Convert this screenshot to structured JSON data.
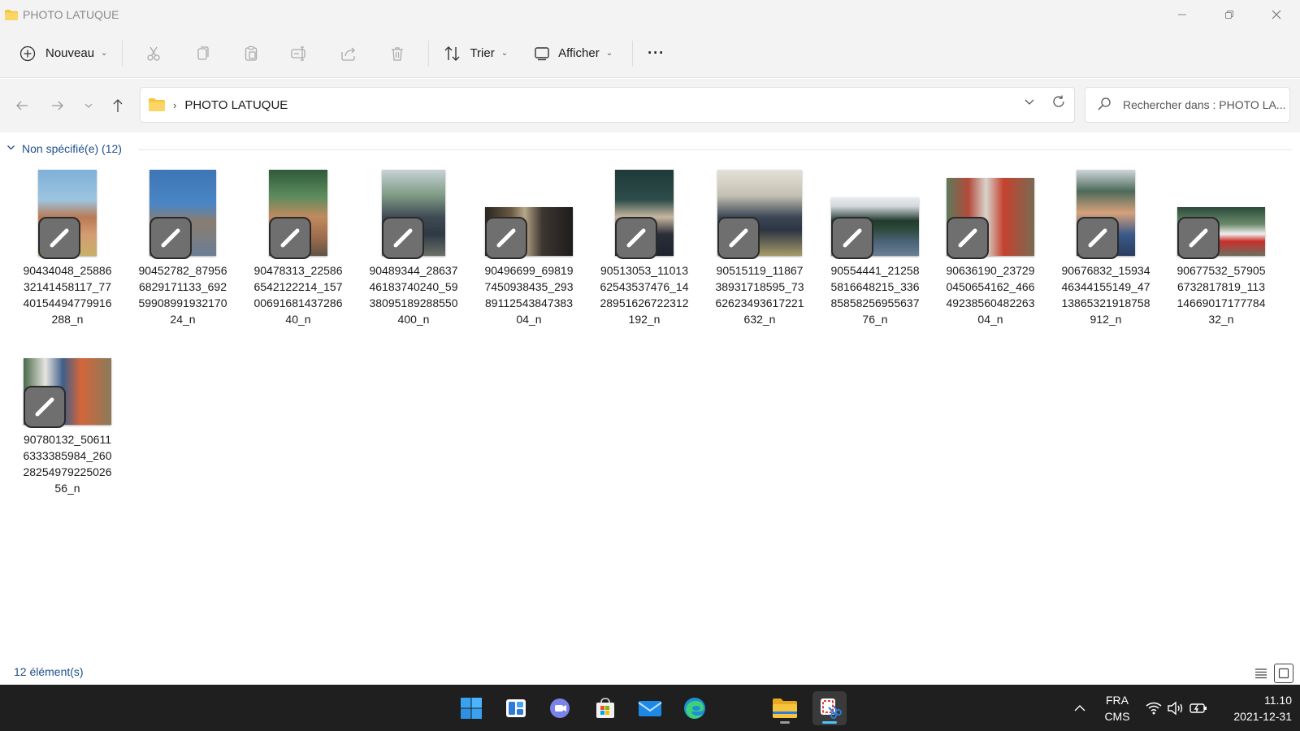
{
  "window": {
    "title": "PHOTO LATUQUE",
    "controls": {
      "minimize": "—",
      "maximize": "❐",
      "close": "✕"
    }
  },
  "toolbar": {
    "new_label": "Nouveau",
    "sort_label": "Trier",
    "view_label": "Afficher",
    "more_label": "···",
    "icons": [
      "cut-icon",
      "copy-icon",
      "paste-icon",
      "rename-icon",
      "share-icon",
      "delete-icon"
    ]
  },
  "address": {
    "crumb": "PHOTO LATUQUE",
    "crumb_separator": "›"
  },
  "search": {
    "placeholder": "Rechercher dans : PHOTO LA..."
  },
  "group": {
    "label": "Non spécifié(e) (12)"
  },
  "files": [
    {
      "name": "90434048_258863214145811 7_7740154494779916288_n",
      "lines": [
        "90434048_25886",
        "32141458117_77",
        "40154494779916",
        "288_n"
      ]
    },
    {
      "lines": [
        "90452782_87956",
        "6829171133_692",
        "59908991932170",
        "24_n"
      ]
    },
    {
      "lines": [
        "90478313_22586",
        "6542122214_157",
        "00691681437286",
        "40_n"
      ]
    },
    {
      "lines": [
        "90489344_28637",
        "46183740240_59",
        "38095189288550",
        "400_n"
      ]
    },
    {
      "lines": [
        "90496699_69819",
        "7450938435_293",
        "89112543847383",
        "04_n"
      ]
    },
    {
      "lines": [
        "90513053_11013",
        "62543537476_14",
        "28951626722312",
        "192_n"
      ]
    },
    {
      "lines": [
        "90515119_11867",
        "38931718595_73",
        "62623493617221",
        "632_n"
      ]
    },
    {
      "lines": [
        "90554441_21258",
        "5816648215_336",
        "85858256955637",
        "76_n"
      ]
    },
    {
      "lines": [
        "90636190_23729",
        "0450654162_466",
        "49238560482263",
        "04_n"
      ]
    },
    {
      "lines": [
        "90676832_15934",
        "46344155149_47",
        "13865321918758",
        "912_n"
      ]
    },
    {
      "lines": [
        "90677532_57905",
        "6732817819_113",
        "14669017177784",
        "32_n"
      ]
    },
    {
      "lines": [
        "90780132_50611",
        "6333385984_260",
        "28254979225026",
        "56_n"
      ]
    }
  ],
  "status": {
    "count": "12 élément(s)"
  },
  "taskbar": {
    "apps": [
      "windows-start-icon",
      "widgets-icon",
      "teams-chat-icon",
      "store-icon",
      "mail-icon",
      "edge-icon",
      "file-explorer-icon",
      "snipping-tool-icon"
    ],
    "tray_chevron": "^",
    "lang_line1": "FRA",
    "lang_line2": "CMS",
    "time": "11.10",
    "date": "2021-12-31"
  },
  "colors": {
    "accent": "#1f4e8c",
    "chrome": "#f3f3f3",
    "taskbar": "#1f1f1f",
    "folder": "#f8c43a"
  }
}
